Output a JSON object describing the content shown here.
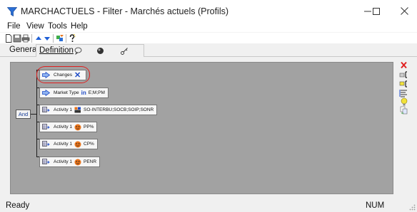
{
  "window": {
    "title": "MARCHACTUELS - Filter - Marchés actuels (Profils)",
    "minimize_glyph": "—",
    "maximize_glyph": "☐",
    "close_glyph": "✕"
  },
  "menu": {
    "file": "File",
    "view": "View",
    "tools": "Tools",
    "help": "Help"
  },
  "toolbar": {
    "icons": [
      "new-icon",
      "save-icon",
      "print-icon",
      "move-up-icon",
      "move-down-icon",
      "filter-icon",
      "help-icon"
    ]
  },
  "tabs": {
    "general": "General",
    "definition": "Definition",
    "icons": [
      "chat-icon",
      "sphere-icon",
      "key-icon"
    ]
  },
  "tree": {
    "root_operator": "And",
    "nodes": [
      {
        "label": "Changes",
        "operator": "✕",
        "value": "",
        "highlighted": true
      },
      {
        "label": "Market Type",
        "operator": "in",
        "value": "E;M;PM"
      },
      {
        "label": "Activity 1",
        "operator": "in",
        "value": "SO-INTERBU;SOCB;SOIP;SONR"
      },
      {
        "label": "Activity 1",
        "operator": "like",
        "value": "PP%"
      },
      {
        "label": "Activity 1",
        "operator": "like",
        "value": "CP%"
      },
      {
        "label": "Activity 1",
        "operator": "like",
        "value": "PENR"
      }
    ]
  },
  "side_toolbar": {
    "icons": [
      "delete-icon",
      "insert-condition-icon",
      "insert-group-icon",
      "properties-icon",
      "hint-icon",
      "copy-icon"
    ]
  },
  "colors": {
    "canvas": "#a2a2a2",
    "highlight": "#e02020",
    "operator_blue": "#1f4cc7",
    "like_orange": "#e8731a"
  },
  "status": {
    "text": "Ready",
    "num": "NUM"
  }
}
